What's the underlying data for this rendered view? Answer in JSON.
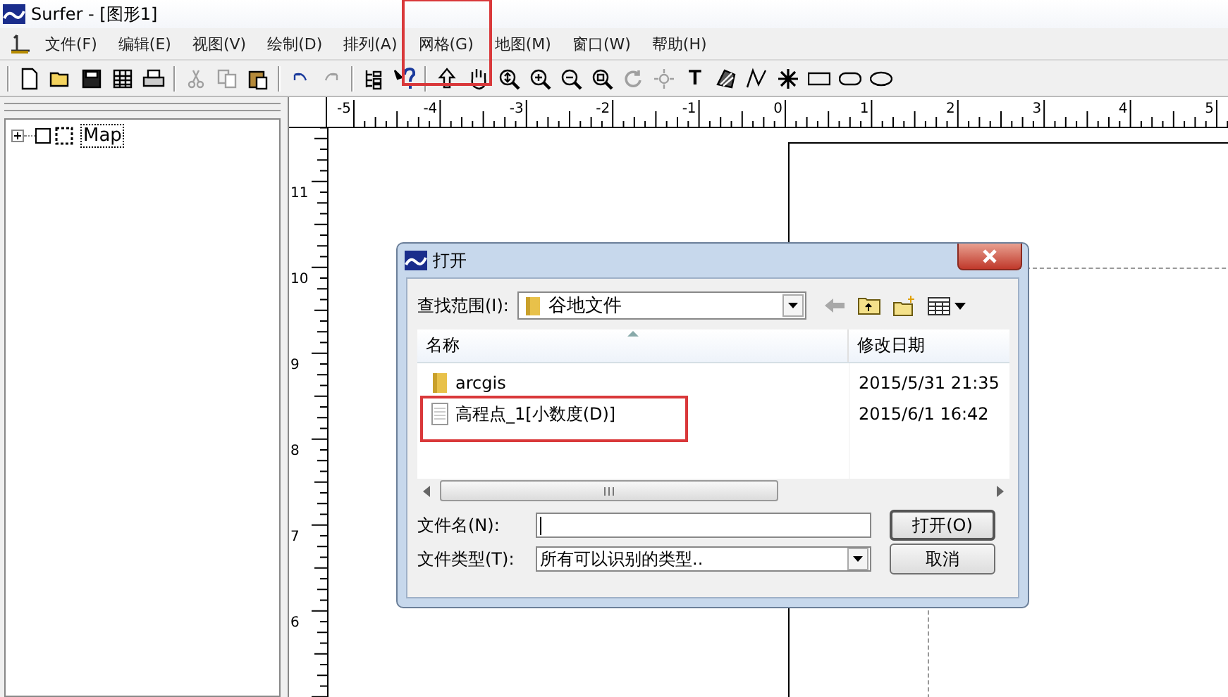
{
  "window": {
    "title": "Surfer - [图形1]"
  },
  "menu": [
    {
      "label": "文件(F)"
    },
    {
      "label": "编辑(E)"
    },
    {
      "label": "视图(V)"
    },
    {
      "label": "绘制(D)"
    },
    {
      "label": "排列(A)"
    },
    {
      "label": "网格(G)",
      "highlighted": true
    },
    {
      "label": "地图(M)"
    },
    {
      "label": "窗口(W)"
    },
    {
      "label": "帮助(H)"
    }
  ],
  "toolbar": [
    [
      {
        "kind": "new",
        "disabled": false
      },
      {
        "kind": "open",
        "disabled": false
      },
      {
        "kind": "save",
        "disabled": false
      },
      {
        "kind": "worksheet",
        "disabled": false
      },
      {
        "kind": "print",
        "disabled": false
      }
    ],
    [
      {
        "kind": "cut",
        "disabled": true
      },
      {
        "kind": "copy",
        "disabled": true
      },
      {
        "kind": "paste",
        "disabled": false
      }
    ],
    [
      {
        "kind": "undo",
        "disabled": false
      },
      {
        "kind": "redo",
        "disabled": true
      }
    ],
    [
      {
        "kind": "tree",
        "disabled": false
      },
      {
        "kind": "help",
        "disabled": false
      }
    ],
    [
      {
        "kind": "select",
        "disabled": false
      },
      {
        "kind": "hand",
        "disabled": false
      },
      {
        "kind": "zoom-fit",
        "disabled": false
      },
      {
        "kind": "zoom-in",
        "disabled": false
      },
      {
        "kind": "zoom-out",
        "disabled": false
      },
      {
        "kind": "zoom-rect",
        "disabled": false
      },
      {
        "kind": "rotate",
        "disabled": true
      },
      {
        "kind": "move",
        "disabled": true
      },
      {
        "kind": "text",
        "label": "T",
        "disabled": false
      },
      {
        "kind": "polygon",
        "disabled": false
      },
      {
        "kind": "polyline",
        "disabled": false
      },
      {
        "kind": "symbol",
        "disabled": false
      },
      {
        "kind": "rectangle",
        "disabled": false
      },
      {
        "kind": "rounded-rectangle",
        "disabled": false
      },
      {
        "kind": "ellipse",
        "disabled": false
      }
    ]
  ],
  "tree": {
    "items": [
      {
        "label": "Map",
        "expanded": false
      }
    ]
  },
  "rulers": {
    "horizontal": [
      "-5",
      "-4",
      "-3",
      "-2",
      "-1",
      "0",
      "1",
      "2",
      "3",
      "4",
      "5"
    ],
    "vertical": [
      "11",
      "10",
      "9",
      "8",
      "7",
      "6"
    ]
  },
  "dialog": {
    "title": "打开",
    "look_in_label": "查找范围(I):",
    "look_in_value": "谷地文件",
    "columns": [
      "名称",
      "修改日期"
    ],
    "files": [
      {
        "kind": "folder",
        "name": "arcgis",
        "modified": "2015/5/31 21:35"
      },
      {
        "kind": "file",
        "highlighted": true,
        "name": "高程点_1[小数度(D)]",
        "modified": "2015/6/1 16:42"
      }
    ],
    "file_name_label": "文件名(N):",
    "file_type_label": "文件类型(T):",
    "file_type_value": "所有可以识别的类型..",
    "buttons": [
      "打开(O)",
      "取消"
    ]
  }
}
